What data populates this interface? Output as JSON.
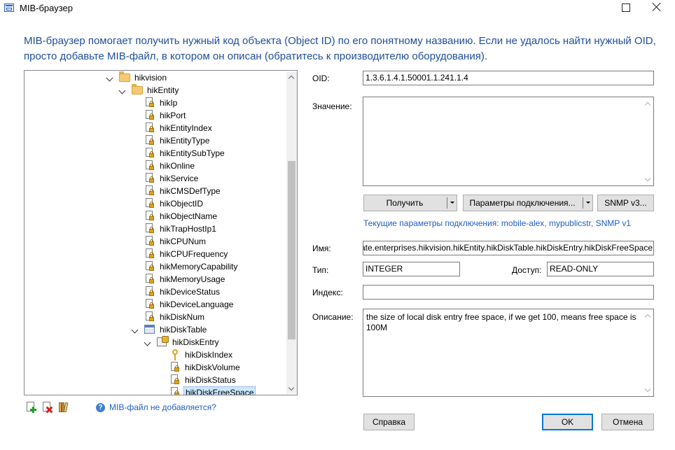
{
  "window": {
    "title": "MIB-браузер"
  },
  "intro": "MIB-браузер помогает получить нужный код объекта (Object ID) по его понятному названию. Если не удалось найти нужный OID, просто добавьте MIB-файл, в котором он описан (обратитесь к производителю оборудования).",
  "tree": {
    "nodes": [
      {
        "label": "hikvision",
        "icon": "folder-icon",
        "expanded": true
      },
      {
        "label": "hikEntity",
        "icon": "folder-icon",
        "expanded": true
      },
      {
        "label": "hikIp",
        "icon": "locked-leaf-icon"
      },
      {
        "label": "hikPort",
        "icon": "locked-leaf-icon"
      },
      {
        "label": "hikEntityIndex",
        "icon": "locked-leaf-icon"
      },
      {
        "label": "hikEntityType",
        "icon": "locked-leaf-icon"
      },
      {
        "label": "hikEntitySubType",
        "icon": "locked-leaf-icon"
      },
      {
        "label": "hikOnline",
        "icon": "locked-leaf-icon"
      },
      {
        "label": "hikService",
        "icon": "locked-leaf-icon"
      },
      {
        "label": "hikCMSDefType",
        "icon": "locked-leaf-icon"
      },
      {
        "label": "hikObjectID",
        "icon": "locked-leaf-icon"
      },
      {
        "label": "hikObjectName",
        "icon": "locked-leaf-icon"
      },
      {
        "label": "hikTrapHostIp1",
        "icon": "locked-leaf-icon"
      },
      {
        "label": "hikCPUNum",
        "icon": "locked-leaf-icon"
      },
      {
        "label": "hikCPUFrequency",
        "icon": "locked-leaf-icon"
      },
      {
        "label": "hikMemoryCapability",
        "icon": "locked-leaf-icon"
      },
      {
        "label": "hikMemoryUsage",
        "icon": "locked-leaf-icon"
      },
      {
        "label": "hikDeviceStatus",
        "icon": "locked-leaf-icon"
      },
      {
        "label": "hikDeviceLanguage",
        "icon": "locked-leaf-icon"
      },
      {
        "label": "hikDiskNum",
        "icon": "locked-leaf-icon"
      },
      {
        "label": "hikDiskTable",
        "icon": "table-icon",
        "expanded": true
      },
      {
        "label": "hikDiskEntry",
        "icon": "table-entry-icon",
        "expanded": true
      },
      {
        "label": "hikDiskIndex",
        "icon": "key-icon"
      },
      {
        "label": "hikDiskVolume",
        "icon": "locked-leaf-icon"
      },
      {
        "label": "hikDiskStatus",
        "icon": "locked-leaf-icon"
      },
      {
        "label": "hikDiskFreeSpace",
        "icon": "locked-leaf-icon",
        "selected": true
      }
    ]
  },
  "tree_tools": {
    "add": "add-mib-icon",
    "remove": "remove-mib-icon",
    "library": "mib-library-icon",
    "help_link": "MIB-файл не добавляется?"
  },
  "form": {
    "oid_label": "OID:",
    "oid_value": "1.3.6.1.4.1.50001.1.241.1.4",
    "value_label": "Значение:",
    "get_button": "Получить",
    "conn_params_button": "Параметры подключения...",
    "snmp_button": "SNMP v3...",
    "conn_info": "Текущие параметры подключения: mobile-alex, mypublicstr, SNMP v1",
    "name_label": "Имя:",
    "name_value": ".iso.org.dod.internet.private.enterprises.hikvision.hikEntity.hikDiskTable.hikDiskEntry.hikDiskFreeSpace",
    "type_label": "Тип:",
    "type_value": "INTEGER",
    "access_label": "Доступ:",
    "access_value": "READ-ONLY",
    "index_label": "Индекс:",
    "index_value": "",
    "desc_label": "Описание:",
    "desc_value": "the size of local disk entry free space, if we get 100, means free space is 100M"
  },
  "footer": {
    "help_button": "Справка",
    "ok_button": "OK",
    "cancel_button": "Отмена"
  },
  "colors": {
    "link": "#1f5fbf",
    "intro": "#1f4e9a",
    "selection": "#cce8ff"
  }
}
